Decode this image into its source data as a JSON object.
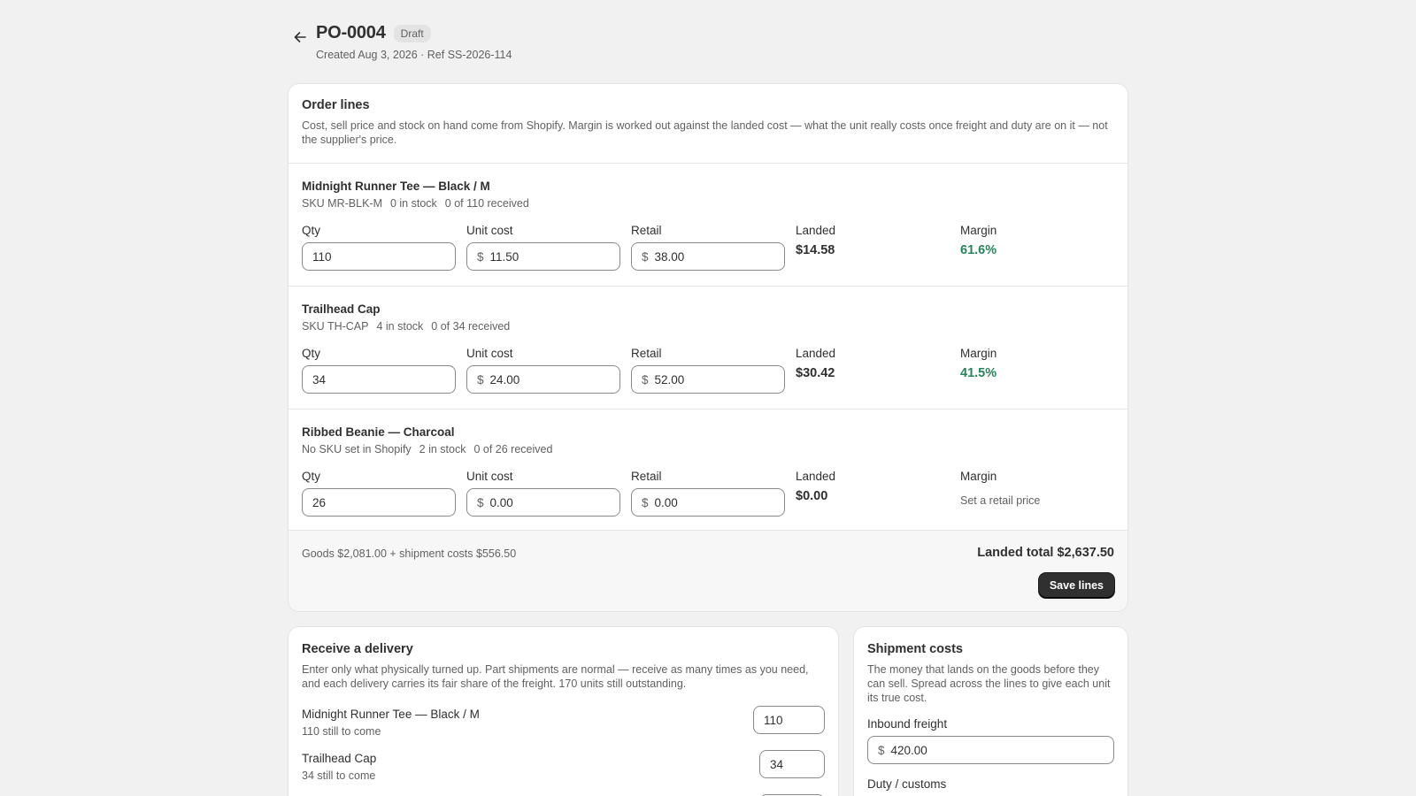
{
  "header": {
    "title": "PO-0004",
    "status_badge": "Draft",
    "subtitle": "Created Aug 3, 2026 · Ref SS-2026-114"
  },
  "order_lines": {
    "title": "Order lines",
    "description": "Cost, sell price and stock on hand come from Shopify. Margin is worked out against the landed cost — what the unit really costs once freight and duty are on it — not the supplier's price.",
    "labels": {
      "qty": "Qty",
      "unit_cost": "Unit cost",
      "retail": "Retail",
      "landed": "Landed",
      "margin": "Margin",
      "currency": "$"
    },
    "lines": [
      {
        "name": "Midnight Runner Tee — Black / M",
        "sku": "SKU MR-BLK-M",
        "stock": "0 in stock",
        "received": "0 of 110 received",
        "qty": "110",
        "unit_cost": "11.50",
        "retail": "38.00",
        "landed": "$14.58",
        "margin": "61.6%"
      },
      {
        "name": "Trailhead Cap",
        "sku": "SKU TH-CAP",
        "stock": "4 in stock",
        "received": "0 of 34 received",
        "qty": "34",
        "unit_cost": "24.00",
        "retail": "52.00",
        "landed": "$30.42",
        "margin": "41.5%"
      },
      {
        "name": "Ribbed Beanie — Charcoal",
        "sku": "No SKU set in Shopify",
        "stock": "2 in stock",
        "received": "0 of 26 received",
        "qty": "26",
        "unit_cost": "0.00",
        "retail": "0.00",
        "landed": "$0.00",
        "margin_hint": "Set a retail price"
      }
    ],
    "summary": "Goods $2,081.00 + shipment costs $556.50",
    "landed_total": "Landed total $2,637.50",
    "save_label": "Save lines"
  },
  "receive": {
    "title": "Receive a delivery",
    "description": "Enter only what physically turned up. Part shipments are normal — receive as many times as you need, and each delivery carries its fair share of the freight. 170 units still outstanding.",
    "items": [
      {
        "name": "Midnight Runner Tee — Black / M",
        "remaining": "110 still to come",
        "value": "110"
      },
      {
        "name": "Trailhead Cap",
        "remaining": "34 still to come",
        "value": "34"
      }
    ]
  },
  "shipment": {
    "title": "Shipment costs",
    "description": "The money that lands on the goods before they can sell. Spread across the lines to give each unit its true cost.",
    "freight_label": "Inbound freight",
    "currency": "$",
    "freight_value": "420.00",
    "duty_label": "Duty / customs"
  },
  "colors": {
    "margin_positive": "#29845a",
    "primary_button": "#303030"
  }
}
